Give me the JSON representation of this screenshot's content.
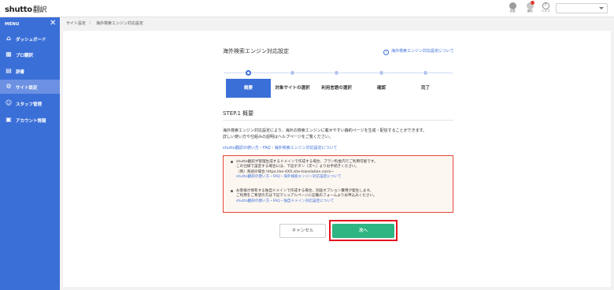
{
  "app": {
    "logo": "shutto",
    "logo_suffix": "翻訳"
  },
  "topbar": {
    "lang_label": "言語",
    "news_label": "通知",
    "help_label": "ヘルプ",
    "help_glyph": "?",
    "user_select_value": ""
  },
  "sidebar": {
    "menu_label": "MENU",
    "close_glyph": "✕",
    "items": [
      {
        "label": "ダッシュボード",
        "icon": "dashboard-icon",
        "glyph": "⌂"
      },
      {
        "label": "プロ翻訳",
        "icon": "pro-translation-icon",
        "glyph": "▦"
      },
      {
        "label": "辞書",
        "icon": "dictionary-icon",
        "glyph": "▤"
      },
      {
        "label": "サイト設定",
        "icon": "gear-icon",
        "glyph": "⚙",
        "active": true
      },
      {
        "label": "スタッフ管理",
        "icon": "staff-icon",
        "glyph": "☺"
      },
      {
        "label": "アカウント情報",
        "icon": "account-icon",
        "glyph": "▣"
      }
    ]
  },
  "breadcrumb": {
    "parent": "サイト設定",
    "separator": "〉",
    "current": "海外検索エンジン対応設定"
  },
  "page": {
    "title": "海外検索エンジン対応設定",
    "help_link": "海外検索エンジン対応設定について",
    "help_glyph": "?"
  },
  "stepper": {
    "steps": [
      {
        "label": "概要",
        "active": true
      },
      {
        "label": "対象サイトの選択",
        "active": false
      },
      {
        "label": "利用言語の選択",
        "active": false
      },
      {
        "label": "確認",
        "active": false
      },
      {
        "label": "完了",
        "active": false
      }
    ]
  },
  "step": {
    "heading": "STEP.1 概要",
    "desc_line1": "海外検索エンジン対応設定により、海外の検索エンジンに載せやすい静的ページを生成・配信することができます。",
    "desc_line2": "詳しい使い方や仕組みの説明はヘルプページをご覧ください。",
    "faq_link": "shutto翻訳の使い方・FAQ・海外検索エンジン対応設定について"
  },
  "notice": {
    "item1_line1": "shutto翻訳が管理生成するドメインで作成する場合、プラン料金内でご利用可能です。",
    "item1_line2": "この仕様で設定する場合には、下記ボタン［次へ］よりお手続きください。",
    "item1_line3": "（例）英語の場合 https://en-XXX.site-translation.com/~",
    "item1_link": "shutto翻訳の使い方・FAQ・海外検索エンジン対応設定について",
    "item2_line1": "お客様が保有する独自ドメインで作成する場合、別途オプション費用が発生します。",
    "item2_line2": "ご利用をご希望の方は下記マニュアルページに記載のフォームよりお申込みください。",
    "item2_link": "shutto翻訳の使い方・FAQ・独自ドメイン対応設定について"
  },
  "buttons": {
    "cancel": "キャンセル",
    "next": "次へ"
  },
  "colors": {
    "sidebar": "#3b6fd8",
    "accent": "#3b6fd8",
    "next_button": "#2eb582",
    "highlight_border": "#e3141f",
    "notice_border": "#e0473a"
  }
}
